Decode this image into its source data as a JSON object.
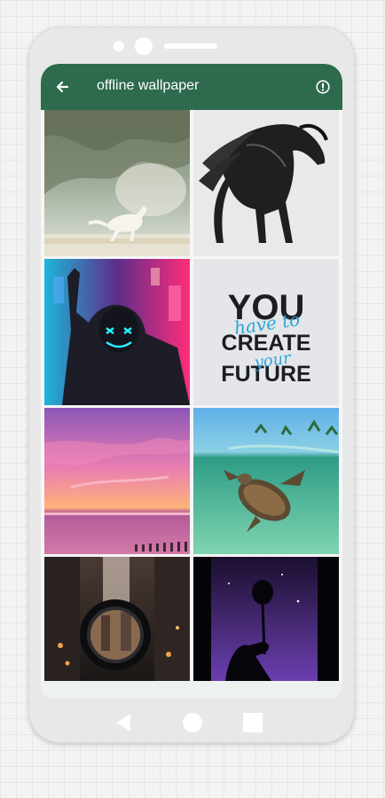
{
  "app": {
    "title": "offline wallpaper",
    "accent_color": "#2e6a4e",
    "back_icon": "arrow-left-icon",
    "info_icon": "info-icon"
  },
  "wallpapers": [
    {
      "subject": "horse-fantasy"
    },
    {
      "subject": "black-horse"
    },
    {
      "subject": "neon-mask"
    },
    {
      "subject": "typography",
      "lines": [
        "YOU",
        "have to",
        "CREATE",
        "your",
        "FUTURE"
      ]
    },
    {
      "subject": "sunset-sea"
    },
    {
      "subject": "sea-turtle"
    },
    {
      "subject": "city-lens"
    },
    {
      "subject": "rose-night"
    }
  ],
  "nav": {
    "back_icon": "triangle-back-icon",
    "home_icon": "circle-home-icon",
    "recent_icon": "square-recent-icon"
  }
}
